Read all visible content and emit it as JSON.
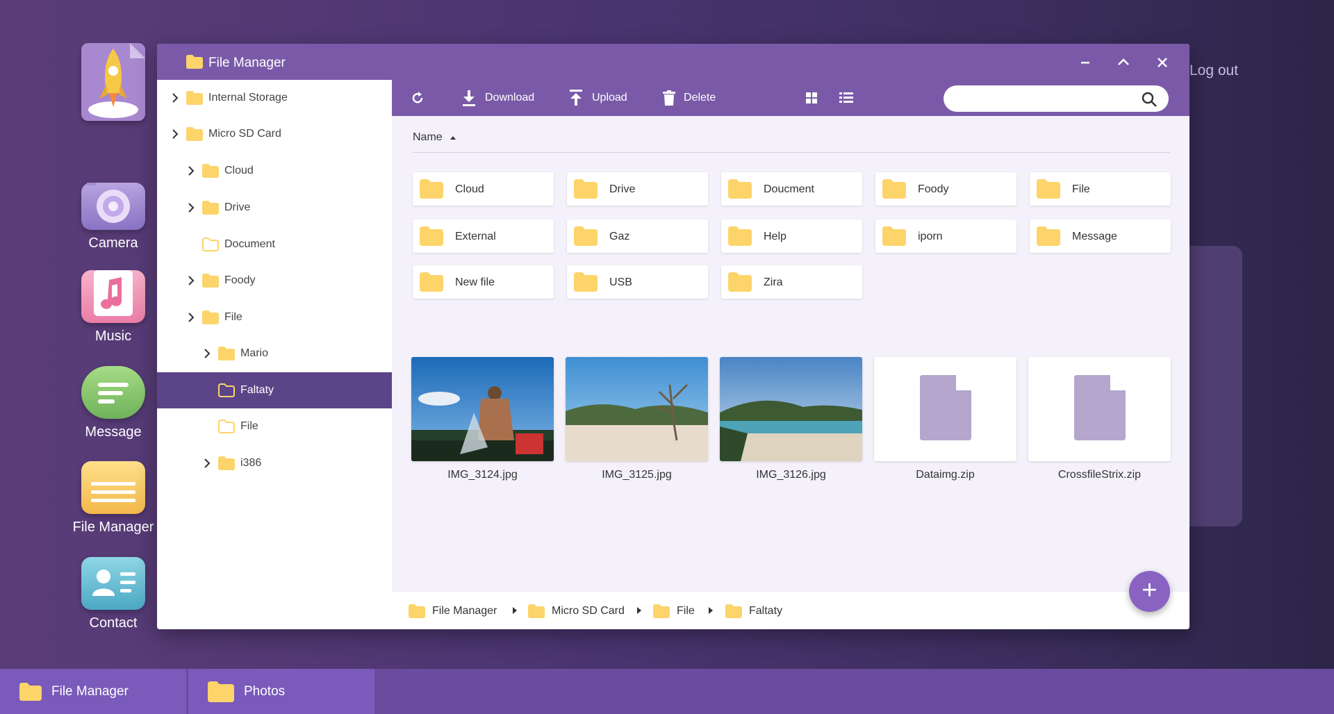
{
  "desktop": {
    "icons": [
      {
        "label": "",
        "icon": "rocket-icon"
      },
      {
        "label": "Camera",
        "icon": "camera-icon"
      },
      {
        "label": "Music",
        "icon": "music-note-icon"
      },
      {
        "label": "Message",
        "icon": "message-bubble-icon"
      },
      {
        "label": "File Manager",
        "icon": "folder-icon"
      },
      {
        "label": "Contact",
        "icon": "contact-card-icon"
      }
    ],
    "logout": "Log out"
  },
  "window": {
    "title": "File Manager",
    "controls": [
      "minimize-icon",
      "maximize-icon",
      "close-icon"
    ]
  },
  "sidebar": {
    "items": [
      {
        "label": "Internal Storage",
        "expandable": true
      },
      {
        "label": "Micro SD Card",
        "expandable": true
      },
      {
        "label": "Cloud",
        "expandable": true
      },
      {
        "label": "Drive",
        "expandable": true
      },
      {
        "label": "Document",
        "expandable": false
      },
      {
        "label": "Foody",
        "expandable": true
      },
      {
        "label": "File",
        "expandable": true
      },
      {
        "label": "Mario",
        "expandable": true
      },
      {
        "label": "Faltaty",
        "expandable": false,
        "selected": true
      },
      {
        "label": "File",
        "expandable": false
      },
      {
        "label": "i386",
        "expandable": true
      }
    ]
  },
  "toolbar": {
    "refresh_icon": "refresh-icon",
    "download_label": "Download",
    "upload_label": "Upload",
    "delete_label": "Delete",
    "grid_view_icon": "grid-view-icon",
    "list_view_icon": "list-view-icon",
    "search_placeholder": ""
  },
  "content": {
    "sort_label": "Name",
    "folders": [
      "Cloud",
      "Drive",
      "Doucment",
      "Foody",
      "File",
      "External",
      "Gaz",
      "Help",
      "iporn",
      "Message",
      "New file",
      "USB",
      "Zira"
    ],
    "files": [
      {
        "name": "IMG_3124.jpg",
        "type": "image"
      },
      {
        "name": "IMG_3125.jpg",
        "type": "image"
      },
      {
        "name": "IMG_3126.jpg",
        "type": "image"
      },
      {
        "name": "Dataimg.zip",
        "type": "zip"
      },
      {
        "name": "CrossfileStrix.zip",
        "type": "zip"
      }
    ]
  },
  "breadcrumb": [
    "File Manager",
    "Micro SD Card",
    "File",
    "Faltaty"
  ],
  "fab_label": "+",
  "taskbar": [
    {
      "label": "File Manager"
    },
    {
      "label": "Photos"
    }
  ],
  "colors": {
    "accent": "#7a5aa8",
    "selected": "#5b4488",
    "folder": "#fcd46a",
    "fab": "#8a62c2"
  }
}
